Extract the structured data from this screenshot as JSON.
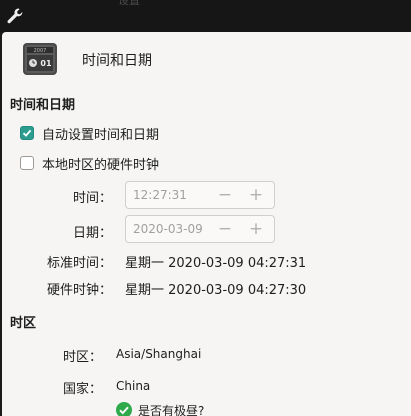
{
  "window": {
    "ghost_title": "设置"
  },
  "header": {
    "title": "时间和日期",
    "icon_day": "01",
    "icon_year": "2007"
  },
  "datetime_section": {
    "title": "时间和日期",
    "auto_set": {
      "label": "自动设置时间和日期",
      "checked": true
    },
    "local_rtc": {
      "label": "本地时区的硬件时钟",
      "checked": false
    },
    "time": {
      "label": "时间：",
      "value": "12:27:31"
    },
    "date": {
      "label": "日期：",
      "value": "2020-03-09"
    },
    "system_time": {
      "label": "标准时间：",
      "value": "星期一 2020-03-09 04:27:31"
    },
    "hardware_time": {
      "label": "硬件时钟：",
      "value": "星期一 2020-03-09 04:27:30"
    }
  },
  "timezone_section": {
    "title": "时区",
    "zone": {
      "label": "时区：",
      "value": "Asia/Shanghai"
    },
    "country": {
      "label": "国家：",
      "value": "China"
    },
    "dst": {
      "label": "是否有极昼?"
    }
  },
  "spin": {
    "minus": "−",
    "plus": "+"
  },
  "colors": {
    "accent": "#2a9d8f",
    "titlebar": "#161616",
    "background": "#f6f5f4"
  }
}
